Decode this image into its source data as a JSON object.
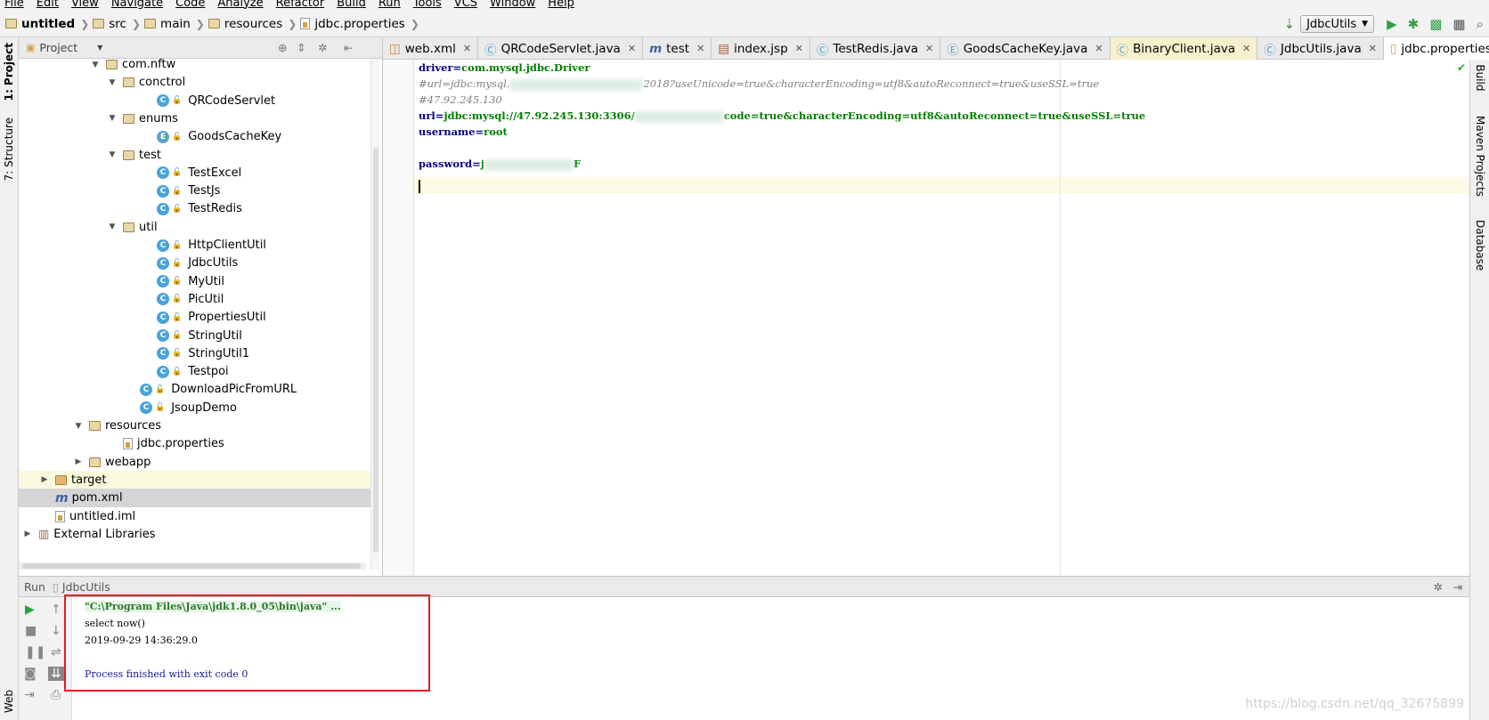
{
  "menu": [
    "File",
    "Edit",
    "View",
    "Navigate",
    "Code",
    "Analyze",
    "Refactor",
    "Build",
    "Run",
    "Tools",
    "VCS",
    "Window",
    "Help"
  ],
  "breadcrumb": [
    "untitled",
    "src",
    "main",
    "resources",
    "jdbc.properties"
  ],
  "run_config": "JdbcUtils",
  "left_tabs": {
    "project": "1: Project",
    "structure": "7: Structure",
    "web": "Web"
  },
  "right_tabs": {
    "ant": "Ant Build",
    "maven": "Maven Projects",
    "database": "Database"
  },
  "project_header": "Project",
  "tree": [
    {
      "label": "com.nftw",
      "type": "pkg",
      "indent": 4,
      "expanded": true
    },
    {
      "label": "conctrol",
      "type": "pkg",
      "indent": 5,
      "expanded": true
    },
    {
      "label": "QRCodeServlet",
      "type": "class",
      "indent": 7
    },
    {
      "label": "enums",
      "type": "pkg",
      "indent": 5,
      "expanded": true
    },
    {
      "label": "GoodsCacheKey",
      "type": "enum",
      "indent": 7
    },
    {
      "label": "test",
      "type": "pkg",
      "indent": 5,
      "expanded": true
    },
    {
      "label": "TestExcel",
      "type": "runclass",
      "indent": 7
    },
    {
      "label": "TestJs",
      "type": "runclass",
      "indent": 7
    },
    {
      "label": "TestRedis",
      "type": "runclass",
      "indent": 7
    },
    {
      "label": "util",
      "type": "pkg",
      "indent": 5,
      "expanded": true
    },
    {
      "label": "HttpClientUtil",
      "type": "runclass",
      "indent": 7
    },
    {
      "label": "JdbcUtils",
      "type": "runclass",
      "indent": 7
    },
    {
      "label": "MyUtil",
      "type": "runclass",
      "indent": 7
    },
    {
      "label": "PicUtil",
      "type": "class",
      "indent": 7
    },
    {
      "label": "PropertiesUtil",
      "type": "class",
      "indent": 7
    },
    {
      "label": "StringUtil",
      "type": "class",
      "indent": 7
    },
    {
      "label": "StringUtil1",
      "type": "class",
      "indent": 7
    },
    {
      "label": "Testpoi",
      "type": "runclass",
      "indent": 7
    },
    {
      "label": "DownloadPicFromURL",
      "type": "runclass",
      "indent": 6
    },
    {
      "label": "JsoupDemo",
      "type": "runclass",
      "indent": 6
    },
    {
      "label": "resources",
      "type": "resfolder",
      "indent": 3,
      "expanded": true
    },
    {
      "label": "jdbc.properties",
      "type": "props",
      "indent": 5
    },
    {
      "label": "webapp",
      "type": "webfolder",
      "indent": 3,
      "expanded": false
    },
    {
      "label": "target",
      "type": "folder",
      "indent": 1,
      "expanded": false,
      "highlight": "yellow"
    },
    {
      "label": "pom.xml",
      "type": "maven",
      "indent": 1,
      "highlight": "gray"
    },
    {
      "label": "untitled.iml",
      "type": "file",
      "indent": 1
    },
    {
      "label": "External Libraries",
      "type": "libs",
      "indent": 0,
      "expanded": false
    }
  ],
  "tabs": [
    {
      "label": "web.xml",
      "icon": "xml"
    },
    {
      "label": "QRCodeServlet.java",
      "icon": "class"
    },
    {
      "label": "test",
      "icon": "maven"
    },
    {
      "label": "index.jsp",
      "icon": "jsp"
    },
    {
      "label": "TestRedis.java",
      "icon": "class"
    },
    {
      "label": "GoodsCacheKey.java",
      "icon": "enum"
    },
    {
      "label": "BinaryClient.java",
      "icon": "class",
      "yellow": true
    },
    {
      "label": "JdbcUtils.java",
      "icon": "class"
    },
    {
      "label": "jdbc.properties",
      "icon": "props",
      "active": true
    }
  ],
  "code": {
    "line1_key": "driver",
    "line1_val": "com.mysql.jdbc.Driver",
    "line2_a": "#url=jdbc:mysql.",
    "line2_b": "2018?useUnicode=true&characterEncoding=utf8&autoReconnect=true&useSSL=true",
    "line3": "#47.92.245.130",
    "line4_key": "url",
    "line4_a": "jdbc:mysql://47.92.245.130:3306/",
    "line4_b": "code=true&characterEncoding=utf8&autoReconnect=true&useSSL=true",
    "line5_key": "username",
    "line5_val": "root",
    "line7_key": "password",
    "line7_a": "j",
    "line7_b": "F"
  },
  "run_panel": {
    "title": "Run",
    "config": "JdbcUtils"
  },
  "console": {
    "cmd": "\"C:\\Program Files\\Java\\jdk1.8.0_05\\bin\\java\" ...",
    "out1": "select now()",
    "out2": "2019-09-29 14:36:29.0",
    "exit": "Process finished with exit code 0"
  },
  "watermark": "https://blog.csdn.net/qq_32675899"
}
